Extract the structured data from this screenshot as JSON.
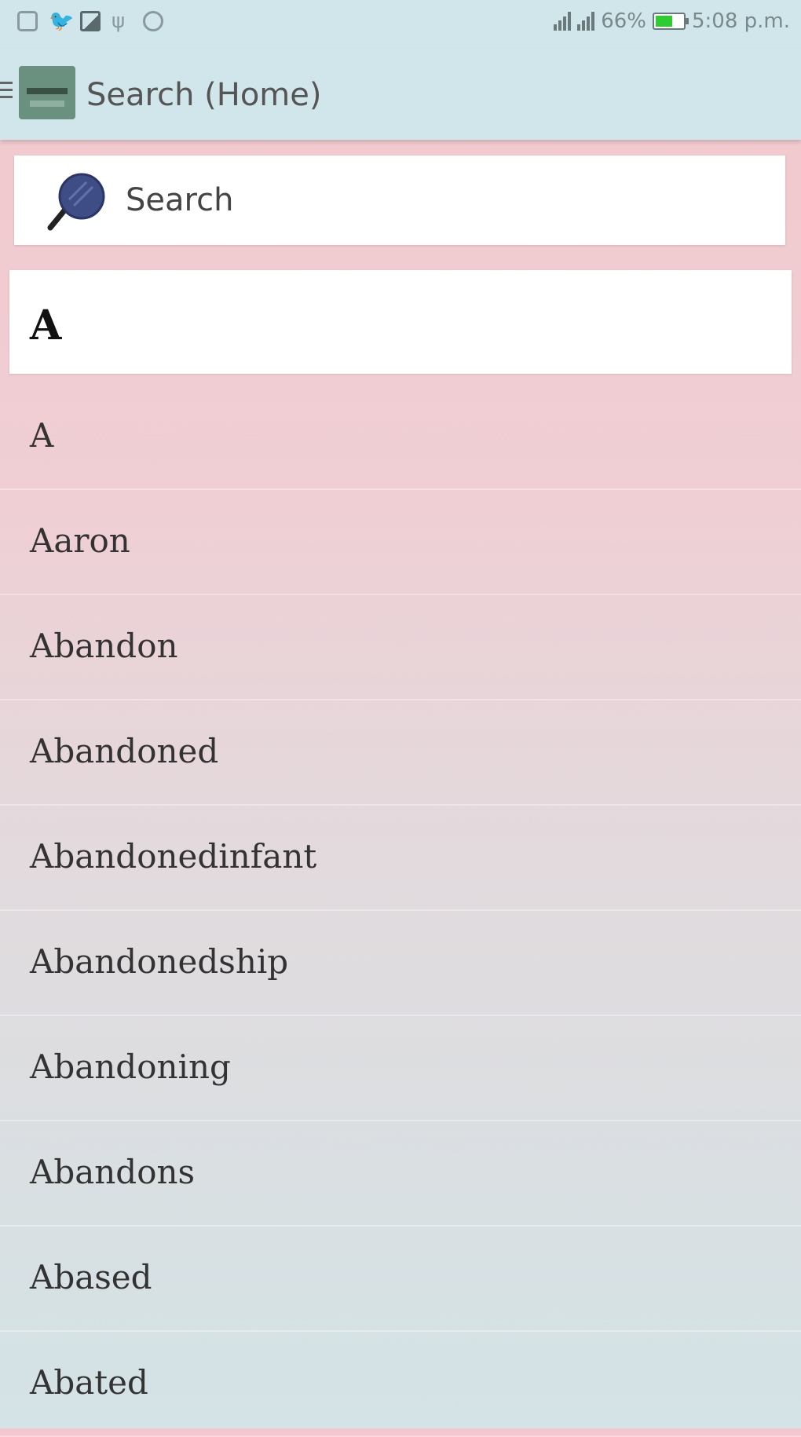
{
  "status_bar": {
    "battery_percent": "66%",
    "battery_level": 0.66,
    "time": "5:08 p.m.",
    "battery_color": "#2ecc2e"
  },
  "app_bar": {
    "title": "Search (Home)"
  },
  "search": {
    "label": "Search"
  },
  "section": {
    "letter": "A"
  },
  "words": [
    {
      "label": "A"
    },
    {
      "label": "Aaron"
    },
    {
      "label": "Abandon"
    },
    {
      "label": "Abandoned"
    },
    {
      "label": "Abandonedinfant"
    },
    {
      "label": "Abandonedship"
    },
    {
      "label": "Abandoning"
    },
    {
      "label": "Abandons"
    },
    {
      "label": "Abased"
    },
    {
      "label": "Abated"
    }
  ]
}
